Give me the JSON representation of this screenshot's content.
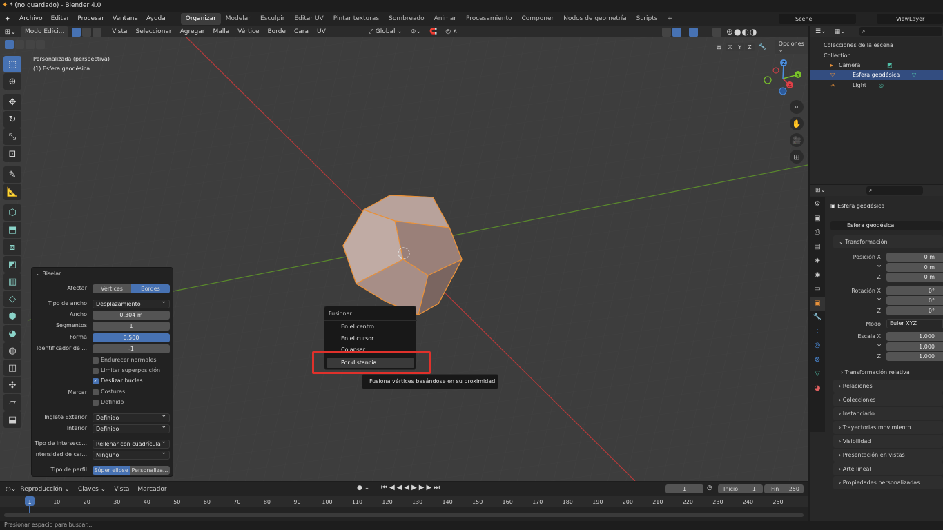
{
  "window": {
    "title": "* (no guardado) - Blender 4.0"
  },
  "menu": {
    "items": [
      "Archivo",
      "Editar",
      "Procesar",
      "Ventana",
      "Ayuda"
    ]
  },
  "workspaces": [
    "Organizar",
    "Modelar",
    "Esculpir",
    "Editar UV",
    "Pintar texturas",
    "Sombreado",
    "Animar",
    "Procesamiento",
    "Componer",
    "Nodos de geometría",
    "Scripts"
  ],
  "scene": {
    "label": "Scene",
    "view_layer": "ViewLayer"
  },
  "viewport_header": {
    "mode": "Modo Edici...",
    "menus": [
      "Vista",
      "Seleccionar",
      "Agregar",
      "Malla",
      "Vértice",
      "Borde",
      "Cara",
      "UV"
    ],
    "orientation": "Global",
    "axes": [
      "X",
      "Y",
      "Z"
    ],
    "options": "Opciones"
  },
  "viewport": {
    "view_name": "Personalizada (perspectiva)",
    "object_name": "(1) Esfera geodésica",
    "gizmo_axes": [
      "X",
      "Y",
      "Z"
    ]
  },
  "bevel": {
    "title": "Biselar",
    "afectar_label": "Afectar",
    "afectar_options": [
      "Vértices",
      "Bordes"
    ],
    "rows": [
      {
        "label": "Tipo de ancho",
        "value": "Desplazamiento",
        "kind": "drop"
      },
      {
        "label": "Ancho",
        "value": "0.304 m",
        "kind": "field"
      },
      {
        "label": "Segmentos",
        "value": "1",
        "kind": "field"
      },
      {
        "label": "Forma",
        "value": "0.500",
        "kind": "slider"
      },
      {
        "label": "Identificador de ...",
        "value": "-1",
        "kind": "field"
      }
    ],
    "checks": [
      {
        "label": "Endurecer normales",
        "on": false
      },
      {
        "label": "Limitar superposición",
        "on": false
      },
      {
        "label": "Deslizar bucles",
        "on": true
      }
    ],
    "marcar_label": "Marcar",
    "marcar_checks": [
      {
        "label": "Costuras",
        "on": false
      },
      {
        "label": "Definido",
        "on": false
      }
    ],
    "inglete_exterior_label": "Inglete  Exterior",
    "inglete_exterior_value": "Definido",
    "interior_label": "Interior",
    "interior_value": "Definido",
    "tipo_interseccion_label": "Tipo de intersecc...",
    "tipo_interseccion_value": "Rellenar con cuadrícula",
    "intensidad_label": "Intensidad de car...",
    "intensidad_value": "Ninguno",
    "tipo_perfil_label": "Tipo de perfil",
    "perfil_options": [
      "Súper elipse",
      "Personaliza..."
    ]
  },
  "fusion_menu": {
    "title": "Fusionar",
    "items": [
      "En el centro",
      "En el cursor",
      "Colapsar",
      "Por distancia"
    ],
    "tooltip": "Fusiona vértices basándose en su proximidad."
  },
  "outliner": {
    "root": "Colecciones de la escena",
    "collection": "Collection",
    "items": [
      "Camera",
      "Esfera geodésica",
      "Light"
    ]
  },
  "properties": {
    "object_name": "Esfera geodésica",
    "data_name": "Esfera geodésica",
    "transform_title": "Transformación",
    "position": [
      {
        "label": "Posición X",
        "value": "0 m"
      },
      {
        "label": "Y",
        "value": "0 m"
      },
      {
        "label": "Z",
        "value": "0 m"
      }
    ],
    "rotation": [
      {
        "label": "Rotación X",
        "value": "0°"
      },
      {
        "label": "Y",
        "value": "0°"
      },
      {
        "label": "Z",
        "value": "0°"
      }
    ],
    "mode_label": "Modo",
    "mode_value": "Euler XYZ",
    "scale": [
      {
        "label": "Escala X",
        "value": "1.000"
      },
      {
        "label": "Y",
        "value": "1.000"
      },
      {
        "label": "Z",
        "value": "1.000"
      }
    ],
    "relative": "Transformación relativa",
    "sections": [
      "Relaciones",
      "Colecciones",
      "Instanciado",
      "Trayectorias movimiento",
      "Visibilidad",
      "Presentación en vistas",
      "Arte lineal",
      "Propiedades personalizadas"
    ]
  },
  "timeline": {
    "menus": [
      "Reproducción",
      "Claves",
      "Vista",
      "Marcador"
    ],
    "current_frame": "1",
    "start_label": "Inicio",
    "start": "1",
    "end_label": "Fin",
    "end": "250",
    "ticks": [
      "1",
      "10",
      "20",
      "30",
      "40",
      "50",
      "60",
      "70",
      "80",
      "90",
      "100",
      "110",
      "120",
      "130",
      "140",
      "150",
      "160",
      "170",
      "180",
      "190",
      "200",
      "210",
      "220",
      "230",
      "240",
      "250"
    ]
  },
  "status": {
    "hint": "Presionar espacio para buscar..."
  },
  "colors": {
    "accent": "#4772b3",
    "selection": "#e8913a",
    "highlight_box": "#e0312b"
  }
}
